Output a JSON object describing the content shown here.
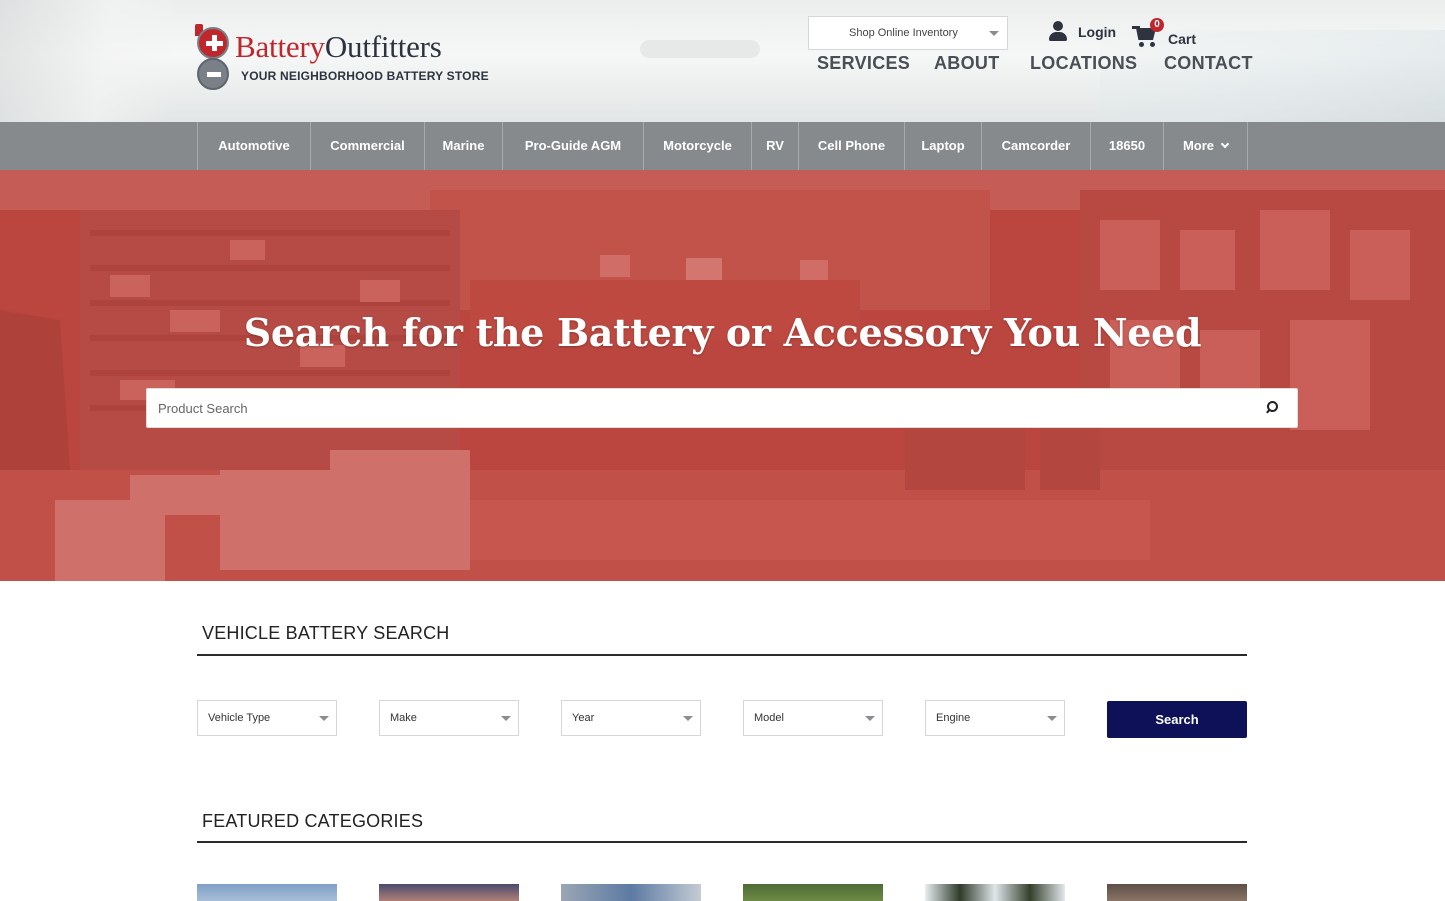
{
  "header": {
    "logo": {
      "name_part1": "Battery",
      "name_part2": "Outfitters",
      "tagline": "YOUR NEIGHBORHOOD BATTERY STORE"
    },
    "shop_select": {
      "selected": "Shop Online Inventory"
    },
    "login_label": "Login",
    "cart": {
      "label": "Cart",
      "count": "0"
    },
    "nav": [
      "SERVICES",
      "ABOUT",
      "LOCATIONS",
      "CONTACT"
    ]
  },
  "categories": [
    "Automotive",
    "Commercial",
    "Marine",
    "Pro-Guide AGM",
    "Motorcycle",
    "RV",
    "Cell Phone",
    "Laptop",
    "Camcorder",
    "18650",
    "More"
  ],
  "hero": {
    "title": "Search for the Battery or Accessory You Need",
    "search_placeholder": "Product Search"
  },
  "vehicle_search": {
    "title": "VEHICLE BATTERY SEARCH",
    "fields": [
      "Vehicle Type",
      "Make",
      "Year",
      "Model",
      "Engine"
    ],
    "button_label": "Search"
  },
  "featured": {
    "title": "FEATURED CATEGORIES"
  },
  "colors": {
    "brand_red": "#c0272d",
    "brand_navy": "#0e1158",
    "category_bar": "#868a8d"
  }
}
